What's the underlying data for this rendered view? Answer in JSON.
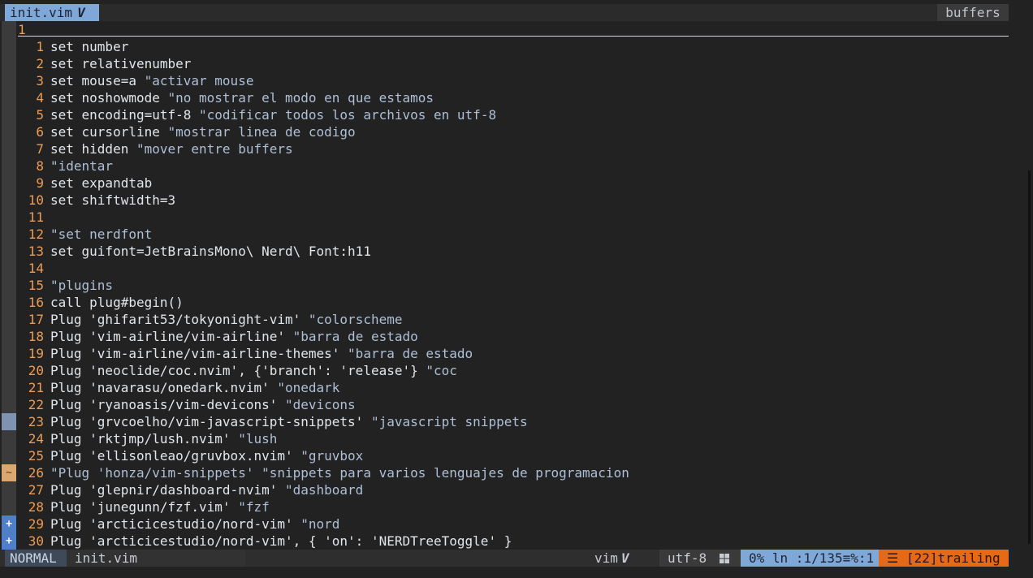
{
  "tabline": {
    "active_tab": "init.vim",
    "active_tab_icon": "vim-logo-icon",
    "vim_glyph": "V",
    "buffers_label": "buffers"
  },
  "cursorline": {
    "number": "1"
  },
  "lines": [
    {
      "n": "1",
      "sign": "",
      "code": "set number",
      "comment": ""
    },
    {
      "n": "2",
      "sign": "",
      "code": "set relativenumber",
      "comment": ""
    },
    {
      "n": "3",
      "sign": "",
      "code": "set mouse=a ",
      "comment": "\"activar mouse"
    },
    {
      "n": "4",
      "sign": "",
      "code": "set noshowmode ",
      "comment": "\"no mostrar el modo en que estamos"
    },
    {
      "n": "5",
      "sign": "",
      "code": "set encoding=utf-8 ",
      "comment": "\"codificar todos los archivos en utf-8"
    },
    {
      "n": "6",
      "sign": "",
      "code": "set cursorline ",
      "comment": "\"mostrar linea de codigo"
    },
    {
      "n": "7",
      "sign": "",
      "code": "set hidden ",
      "comment": "\"mover entre buffers"
    },
    {
      "n": "8",
      "sign": "",
      "code": "",
      "comment": "\"identar"
    },
    {
      "n": "9",
      "sign": "",
      "code": "set expandtab",
      "comment": ""
    },
    {
      "n": "10",
      "sign": "",
      "code": "set shiftwidth=3",
      "comment": ""
    },
    {
      "n": "11",
      "sign": "",
      "code": "",
      "comment": ""
    },
    {
      "n": "12",
      "sign": "",
      "code": "",
      "comment": "\"set nerdfont"
    },
    {
      "n": "13",
      "sign": "",
      "code": "set guifont=JetBrainsMono\\ Nerd\\ Font:h11",
      "comment": ""
    },
    {
      "n": "14",
      "sign": "",
      "code": "",
      "comment": ""
    },
    {
      "n": "15",
      "sign": "",
      "code": "",
      "comment": "\"plugins"
    },
    {
      "n": "16",
      "sign": "",
      "code": "call plug#begin()",
      "comment": ""
    },
    {
      "n": "17",
      "sign": "",
      "code": "Plug 'ghifarit53/tokyonight-vim' ",
      "comment": "\"colorscheme"
    },
    {
      "n": "18",
      "sign": "",
      "code": "Plug 'vim-airline/vim-airline' ",
      "comment": "\"barra de estado"
    },
    {
      "n": "19",
      "sign": "",
      "code": "Plug 'vim-airline/vim-airline-themes' ",
      "comment": "\"barra de estado"
    },
    {
      "n": "20",
      "sign": "",
      "code": "Plug 'neoclide/coc.nvim', {'branch': 'release'} ",
      "comment": "\"coc"
    },
    {
      "n": "21",
      "sign": "",
      "code": "Plug 'navarasu/onedark.nvim' ",
      "comment": "\"onedark"
    },
    {
      "n": "22",
      "sign": "",
      "code": "Plug 'ryanoasis/vim-devicons' ",
      "comment": "\"devicons"
    },
    {
      "n": "23",
      "sign": "changed",
      "code": "Plug 'grvcoelho/vim-javascript-snippets' ",
      "comment": "\"javascript snippets"
    },
    {
      "n": "24",
      "sign": "",
      "code": "Plug 'rktjmp/lush.nvim' ",
      "comment": "\"lush"
    },
    {
      "n": "25",
      "sign": "",
      "code": "Plug 'ellisonleao/gruvbox.nvim' ",
      "comment": "\"gruvbox"
    },
    {
      "n": "26",
      "sign": "modified",
      "code": "",
      "comment": "\"Plug 'honza/vim-snippets' \"snippets para varios lenguajes de programacion"
    },
    {
      "n": "27",
      "sign": "",
      "code": "Plug 'glepnir/dashboard-nvim' ",
      "comment": "\"dashboard"
    },
    {
      "n": "28",
      "sign": "",
      "code": "Plug 'junegunn/fzf.vim' ",
      "comment": "\"fzf"
    },
    {
      "n": "29",
      "sign": "added",
      "code": "Plug 'arcticicestudio/nord-vim' ",
      "comment": "\"nord"
    },
    {
      "n": "30",
      "sign": "added",
      "code": "Plug 'arcticicestudio/nord-vim', { 'on': 'NERDTreeToggle' }",
      "comment": ""
    }
  ],
  "signs": {
    "modified": "~",
    "added": "+"
  },
  "statusline": {
    "mode": "NORMAL",
    "filename": "init.vim",
    "filetype": "vim",
    "encoding": "utf-8",
    "encoding_icon": "windows-icon",
    "position": "0%  ln :1/135≡%:1",
    "warning": "☰ [22]trailing"
  },
  "colors": {
    "background": "#222222",
    "line_number": "#ec9c54",
    "comment": "#aebfd6",
    "accent_blue": "#7fa8d8",
    "warning_orange": "#e46a18"
  }
}
